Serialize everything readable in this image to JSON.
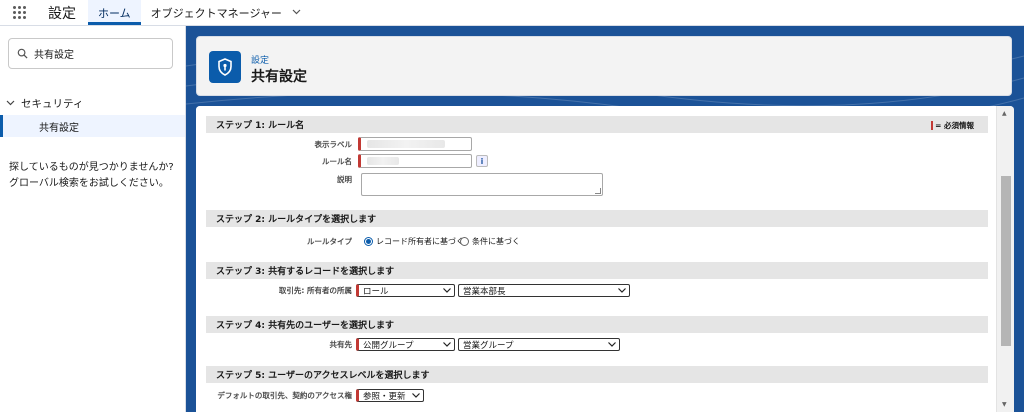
{
  "topbar": {
    "app_name": "設定",
    "tabs": [
      {
        "label": "ホーム",
        "active": true
      },
      {
        "label": "オブジェクトマネージャー",
        "has_dropdown": true
      }
    ]
  },
  "sidebar": {
    "search_value": "共有設定",
    "tree_parent": "セキュリティ",
    "tree_child": "共有設定",
    "help_text_1": "探しているものが見つかりませんか?",
    "help_text_2": "グローバル検索をお試しください。"
  },
  "header": {
    "crumb": "設定",
    "title": "共有設定"
  },
  "form": {
    "required_legend": "= 必須情報",
    "steps": [
      "ステップ 1: ルール名",
      "ステップ 2: ルールタイプを選択します",
      "ステップ 3: 共有するレコードを選択します",
      "ステップ 4: 共有先のユーザーを選択します",
      "ステップ 5: ユーザーのアクセスレベルを選択します"
    ],
    "label_display": "表示ラベル",
    "label_rule_name": "ルール名",
    "label_description": "説明",
    "info_icon": "i",
    "label_rule_type": "ルールタイプ",
    "radio_owner": "レコード所有者に基づく",
    "radio_criteria": "条件に基づく",
    "label_owner_of": "取引先: 所有者の所属",
    "owner_type": "ロール",
    "owner_value": "営業本部長",
    "label_share_with": "共有先",
    "share_type": "公開グループ",
    "share_value": "営業グループ",
    "label_access": "デフォルトの取引先、契約のアクセス権",
    "access_value": "参照・更新"
  },
  "colors": {
    "brand": "#0b5cab",
    "required": "#c23934",
    "main_bg": "#1b5297"
  }
}
